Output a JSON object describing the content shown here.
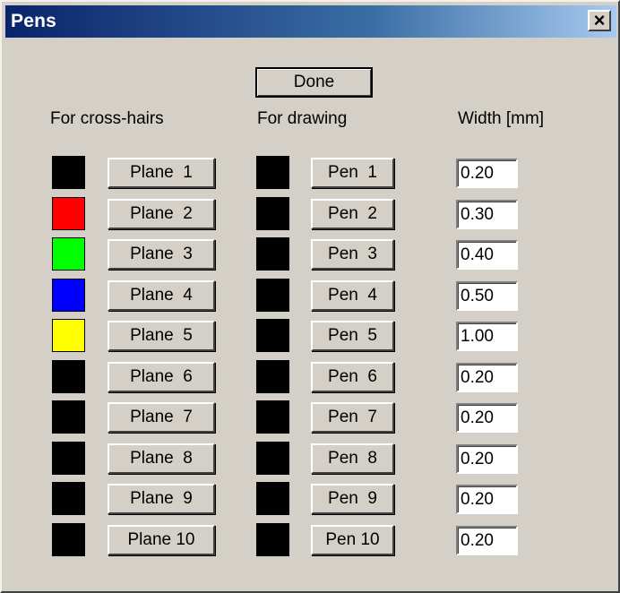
{
  "window": {
    "title": "Pens",
    "close_label": "×"
  },
  "done_label": "Done",
  "headers": {
    "cross_hairs": "For cross-hairs",
    "drawing": "For drawing",
    "width": "Width [mm]"
  },
  "rows": [
    {
      "plane_label": "Plane  1",
      "plane_color": "#000000",
      "pen_label": "Pen  1",
      "pen_color": "#000000",
      "width": "0.20"
    },
    {
      "plane_label": "Plane  2",
      "plane_color": "#ff0000",
      "pen_label": "Pen  2",
      "pen_color": "#000000",
      "width": "0.30"
    },
    {
      "plane_label": "Plane  3",
      "plane_color": "#00ff00",
      "pen_label": "Pen  3",
      "pen_color": "#000000",
      "width": "0.40"
    },
    {
      "plane_label": "Plane  4",
      "plane_color": "#0000ff",
      "pen_label": "Pen  4",
      "pen_color": "#000000",
      "width": "0.50"
    },
    {
      "plane_label": "Plane  5",
      "plane_color": "#ffff00",
      "pen_label": "Pen  5",
      "pen_color": "#000000",
      "width": "1.00"
    },
    {
      "plane_label": "Plane  6",
      "plane_color": "#000000",
      "pen_label": "Pen  6",
      "pen_color": "#000000",
      "width": "0.20"
    },
    {
      "plane_label": "Plane  7",
      "plane_color": "#000000",
      "pen_label": "Pen  7",
      "pen_color": "#000000",
      "width": "0.20"
    },
    {
      "plane_label": "Plane  8",
      "plane_color": "#000000",
      "pen_label": "Pen  8",
      "pen_color": "#000000",
      "width": "0.20"
    },
    {
      "plane_label": "Plane  9",
      "plane_color": "#000000",
      "pen_label": "Pen  9",
      "pen_color": "#000000",
      "width": "0.20"
    },
    {
      "plane_label": "Plane 10",
      "plane_color": "#000000",
      "pen_label": "Pen 10",
      "pen_color": "#000000",
      "width": "0.20"
    }
  ]
}
